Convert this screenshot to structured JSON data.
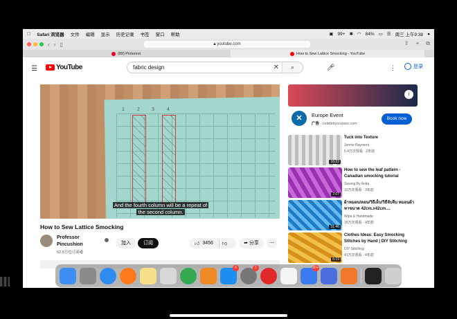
{
  "menubar": {
    "apple": "",
    "app": "Safari 浏览器",
    "items": [
      "文件",
      "编辑",
      "显示",
      "历史记录",
      "书签",
      "窗口",
      "帮助"
    ],
    "status_badge": "99+",
    "battery": "84%",
    "datetime": "周三 上午9:38"
  },
  "toolbar": {
    "url": "youtube.com"
  },
  "tabs": [
    {
      "title": "(89) Pinterest",
      "favicon_color": "#e60023"
    },
    {
      "title": "How to Sew Lattice Smocking - YouTube",
      "favicon_color": "#ff0000"
    }
  ],
  "youtube": {
    "logo": "YouTube",
    "search_value": "fabric design",
    "signin": "登录"
  },
  "video": {
    "caption_line1": "And the fourth column will be a repeat of",
    "caption_line2": "the second column.",
    "column_numbers": [
      "1",
      "2",
      "3",
      "4"
    ],
    "title": "How to Sew Lattice Smocking",
    "channel": "Professor Pincushion",
    "subscribers": "62.8万位订阅者",
    "join": "加入",
    "subscribe": "订阅",
    "likes": "3456",
    "share": "分享"
  },
  "ad": {
    "title": "Europe Event",
    "ad_label": "广告",
    "domain": "celebritycruises.com",
    "button": "Book now"
  },
  "recommendations": [
    {
      "title": "Tuck into Texture",
      "channel": "Jennie Rayment",
      "meta": "5.4万次观看 · 2年前",
      "duration": "16:22",
      "thumb": "#c9c9c9"
    },
    {
      "title": "How to sew the leaf pattern - Canadian smocking tutorial",
      "channel": "Sewing By Anita",
      "meta": "10万次观看 · 3年前",
      "duration": "7:07",
      "thumb": "#a63bb8"
    },
    {
      "title": "ผ้าหมอน/ลอน/วิธีเย็บ/วิธีจับจีบ หมอนผ้าทาขนาด 42cm.x42cm....",
      "channel": "Wipa & Handmade",
      "meta": "16万次观看 · 4年前",
      "duration": "31:46",
      "thumb": "#2f8fd0"
    },
    {
      "title": "Clothes Ideas: Easy Smocking Stitches by Hand | DIY Stitching",
      "channel": "DIY Stitching",
      "meta": "41万次观看 · 4年前",
      "duration": "6:19",
      "thumb": "#e0a020"
    }
  ],
  "dock": {
    "apps": [
      {
        "name": "finder",
        "color": "#3d8ff5"
      },
      {
        "name": "launchpad",
        "color": "#8a8a8a"
      },
      {
        "name": "safari",
        "color": "#2d8cf0"
      },
      {
        "name": "firefox",
        "color": "#ff7a1a"
      },
      {
        "name": "notes",
        "color": "#f7e08a"
      },
      {
        "name": "vpn",
        "color": "#d8d8d8"
      },
      {
        "name": "telegram",
        "color": "#35a852"
      },
      {
        "name": "books",
        "color": "#f08a24"
      },
      {
        "name": "app-store",
        "color": "#1f8ef1",
        "badge": "6"
      },
      {
        "name": "system-preferences",
        "color": "#777777",
        "badge": "1"
      },
      {
        "name": "netease-music",
        "color": "#e02a2a"
      },
      {
        "name": "qq",
        "color": "#f4f4f4"
      },
      {
        "name": "feishu",
        "color": "#3a7bf0",
        "badge": "20+"
      },
      {
        "name": "wps",
        "color": "#4a6ee0"
      },
      {
        "name": "office",
        "color": "#f07a2a"
      }
    ],
    "right": [
      {
        "name": "terminal",
        "color": "#222222"
      },
      {
        "name": "trash",
        "color": "#cfcfcf"
      }
    ]
  }
}
